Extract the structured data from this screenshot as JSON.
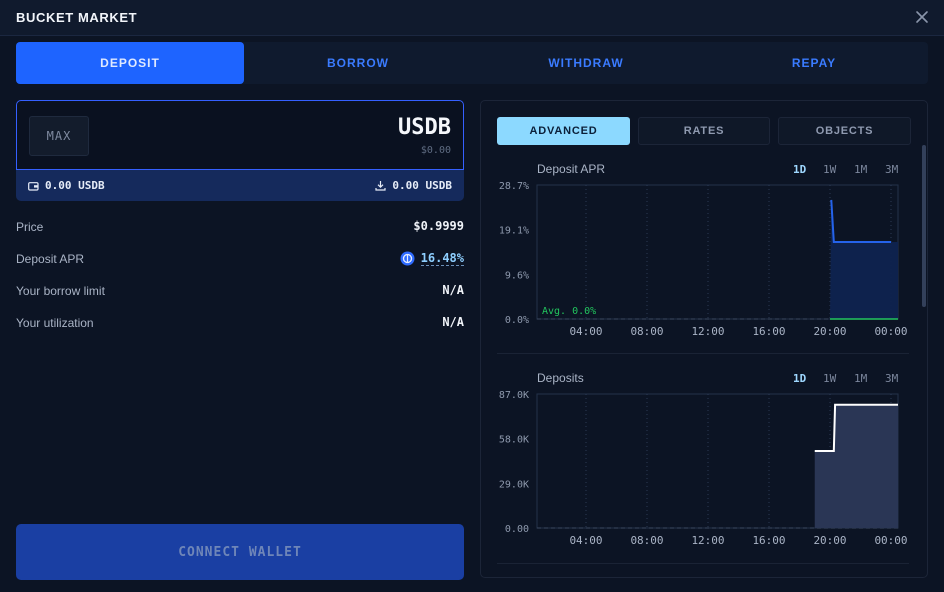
{
  "header": {
    "title": "BUCKET MARKET"
  },
  "tabs": [
    {
      "label": "DEPOSIT",
      "active": true
    },
    {
      "label": "BORROW",
      "active": false
    },
    {
      "label": "WITHDRAW",
      "active": false
    },
    {
      "label": "REPAY",
      "active": false
    }
  ],
  "amount": {
    "max_label": "MAX",
    "token": "USDB",
    "usd_value": "$0.00",
    "wallet_balance": "0.00 USDB",
    "deposited_balance": "0.00 USDB"
  },
  "info": {
    "price_label": "Price",
    "price_value": "$0.9999",
    "apr_label": "Deposit APR",
    "apr_value": "16.48%",
    "borrow_label": "Your borrow limit",
    "borrow_value": "N/A",
    "util_label": "Your utilization",
    "util_value": "N/A"
  },
  "connect_label": "CONNECT WALLET",
  "panel_tabs": [
    "ADVANCED",
    "RATES",
    "OBJECTS"
  ],
  "ranges": [
    "1D",
    "1W",
    "1M",
    "3M"
  ],
  "colors": {
    "accent": "#1e64ff",
    "apr_line": "#2563eb",
    "avg_line": "#22c55e"
  },
  "chart_data": [
    {
      "type": "line",
      "title": "Deposit APR",
      "y_ticks": [
        "28.7%",
        "19.1%",
        "9.6%",
        "0.0%"
      ],
      "x_ticks": [
        "04:00",
        "08:00",
        "12:00",
        "16:00",
        "20:00",
        "00:00"
      ],
      "ylim": [
        0,
        28.7
      ],
      "annotation": "Avg. 0.0%",
      "series": [
        {
          "x": [
            "20:00",
            "20:05",
            "20:15",
            "00:00"
          ],
          "values": [
            0,
            25.5,
            16.5,
            16.5
          ]
        }
      ]
    },
    {
      "type": "area",
      "title": "Deposits",
      "y_ticks": [
        "87.0K",
        "58.0K",
        "29.0K",
        "0.00"
      ],
      "x_ticks": [
        "04:00",
        "08:00",
        "12:00",
        "16:00",
        "20:00",
        "00:00"
      ],
      "ylim": [
        0,
        87000
      ],
      "series": [
        {
          "x": [
            "19:00",
            "20:15",
            "20:20",
            "00:00"
          ],
          "values": [
            50000,
            50000,
            80000,
            80000
          ]
        }
      ]
    }
  ]
}
